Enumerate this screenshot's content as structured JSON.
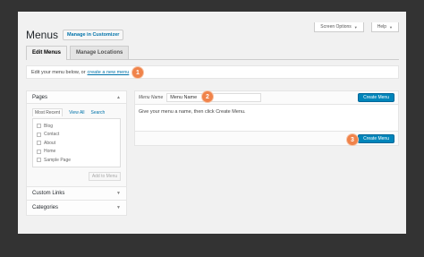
{
  "header": {
    "title": "Menus",
    "customizer_button": "Manage in Customizer",
    "screen_options": "Screen Options",
    "help": "Help"
  },
  "tabs": [
    {
      "label": "Edit Menus",
      "active": true
    },
    {
      "label": "Manage Locations",
      "active": false
    }
  ],
  "notice": {
    "text": "Edit your menu below, or",
    "link": "create a new menu"
  },
  "steps": [
    "1",
    "2",
    "3"
  ],
  "sidebar": {
    "pages": {
      "title": "Pages",
      "subtabs": [
        "Most Recent",
        "View All",
        "Search"
      ],
      "items": [
        "Blog",
        "Contact",
        "About",
        "Home",
        "Sample Page"
      ],
      "add_button": "Add to Menu"
    },
    "custom_links": "Custom Links",
    "categories": "Categories"
  },
  "editor": {
    "menu_name_label": "Menu Name",
    "menu_name_value": "Menu Name",
    "create_button_top": "Create Menu",
    "instruction": "Give your menu a name, then click Create Menu.",
    "create_button_bottom": "Create Menu"
  },
  "colors": {
    "background": "#333333",
    "primary": "#0085ba",
    "step_badge": "#f0834a",
    "link": "#0073aa"
  }
}
